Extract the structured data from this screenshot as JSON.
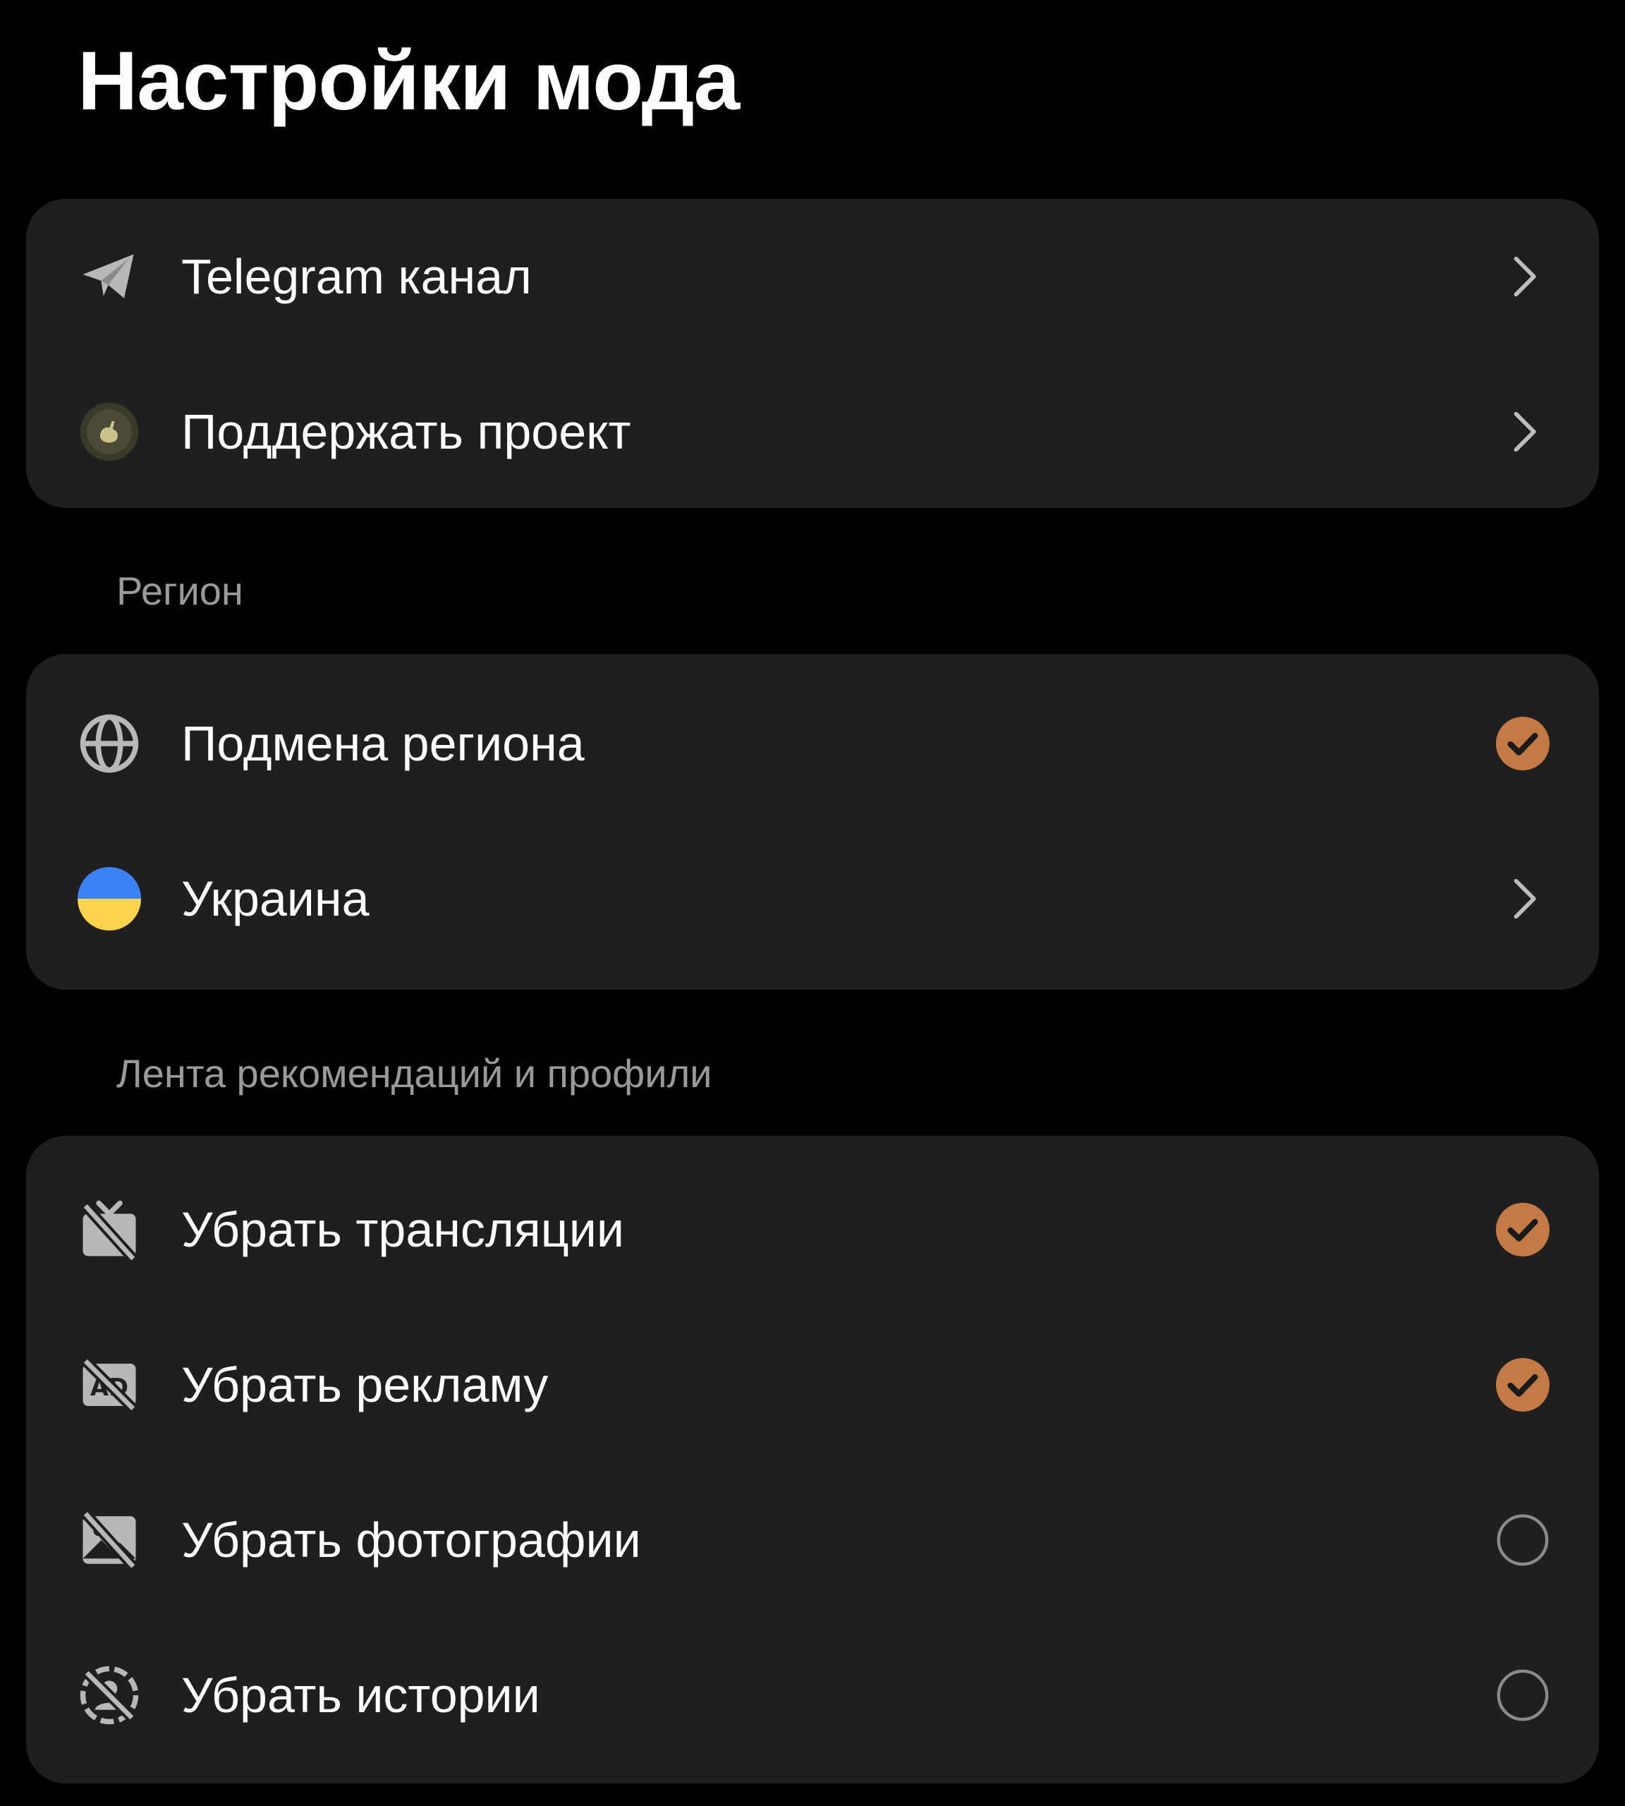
{
  "header": {
    "title": "Настройки мода"
  },
  "colors": {
    "background": "#000000",
    "card": "#1f1f1f",
    "accent": "#c47a45",
    "icon": "#b8b8b8",
    "section_label": "#9a9a9a"
  },
  "links": {
    "items": [
      {
        "label": "Telegram канал",
        "icon": "telegram-send-icon",
        "trailing": "chevron"
      },
      {
        "label": "Поддержать проект",
        "icon": "support-badge-icon",
        "trailing": "chevron"
      }
    ]
  },
  "region": {
    "section_label": "Регион",
    "items": [
      {
        "label": "Подмена региона",
        "icon": "globe-icon",
        "trailing": "check",
        "checked": true
      },
      {
        "label": "Украина",
        "icon": "ukraine-flag-icon",
        "trailing": "chevron"
      }
    ]
  },
  "feed": {
    "section_label": "Лента рекомендаций и профили",
    "items": [
      {
        "label": "Убрать трансляции",
        "icon": "tv-off-icon",
        "checked": true
      },
      {
        "label": "Убрать рекламу",
        "icon": "ads-off-icon",
        "checked": true
      },
      {
        "label": "Убрать фотографии",
        "icon": "image-off-icon",
        "checked": false
      },
      {
        "label": "Убрать истории",
        "icon": "stories-off-icon",
        "checked": false
      }
    ]
  }
}
